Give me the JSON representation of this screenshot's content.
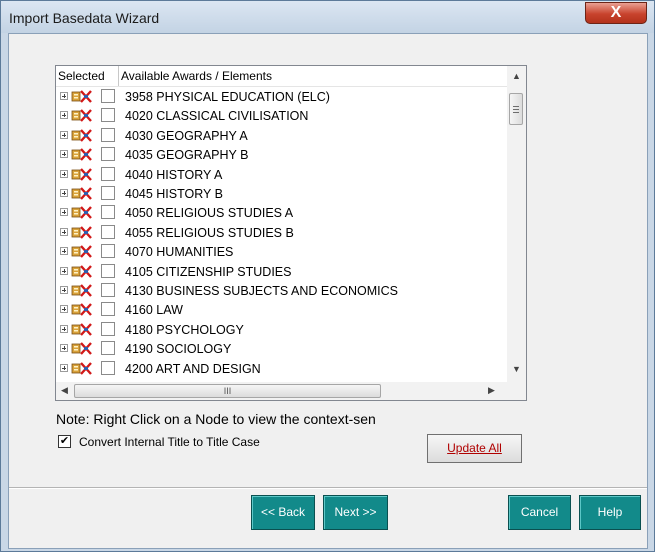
{
  "window": {
    "title": "Import Basedata Wizard",
    "close_glyph": "X"
  },
  "tree": {
    "columns": [
      "Selected",
      "Available Awards / Elements"
    ],
    "rows": [
      "3958 PHYSICAL EDUCATION (ELC)",
      "4020 CLASSICAL CIVILISATION",
      "4030 GEOGRAPHY A",
      "4035 GEOGRAPHY B",
      "4040 HISTORY A",
      "4045 HISTORY B",
      "4050 RELIGIOUS STUDIES A",
      "4055 RELIGIOUS STUDIES B",
      "4070 HUMANITIES",
      "4105 CITIZENSHIP STUDIES",
      "4130 BUSINESS SUBJECTS AND ECONOMICS",
      "4160 LAW",
      "4180 PSYCHOLOGY",
      "4190 SOCIOLOGY",
      "4200 ART AND DESIGN"
    ],
    "hscroll_grip": "III"
  },
  "note": "Note: Right Click on a Node to view the context-sen",
  "convert": {
    "label": "Convert Internal Title to Title Case",
    "checked": true,
    "check_glyph": "✔"
  },
  "buttons": {
    "update_all": "Update All",
    "back": "<< Back",
    "next": "Next >>",
    "cancel": "Cancel",
    "help": "Help"
  },
  "colors": {
    "teal_button": "#128a8a",
    "titlebar": "#c9d7e6",
    "close_red": "#c8432d",
    "update_text": "#b00000"
  },
  "icons": {
    "row_expand": "plus-expander-icon",
    "row_icon": "award-element-icon",
    "scroll_up": "arrow-up-icon",
    "scroll_down": "arrow-down-icon",
    "scroll_left": "arrow-left-icon",
    "scroll_right": "arrow-right-icon"
  }
}
